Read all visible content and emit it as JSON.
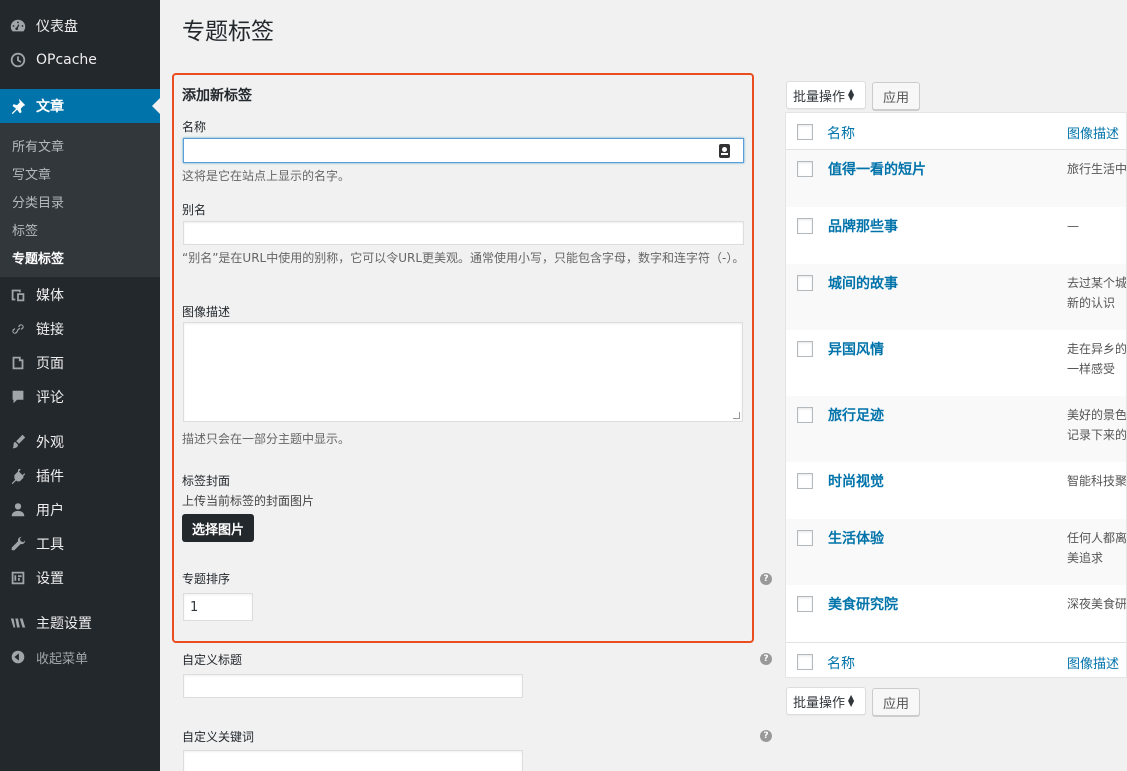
{
  "sidebar": {
    "items": [
      {
        "label": "仪表盘",
        "icon": "dashboard-icon"
      },
      {
        "label": "OPcache",
        "icon": "clock-icon"
      },
      {
        "label": "文章",
        "icon": "pin-icon"
      },
      {
        "label": "媒体",
        "icon": "media-icon"
      },
      {
        "label": "链接",
        "icon": "link-icon"
      },
      {
        "label": "页面",
        "icon": "page-icon"
      },
      {
        "label": "评论",
        "icon": "comment-icon"
      },
      {
        "label": "外观",
        "icon": "brush-icon"
      },
      {
        "label": "插件",
        "icon": "plugin-icon"
      },
      {
        "label": "用户",
        "icon": "user-icon"
      },
      {
        "label": "工具",
        "icon": "wrench-icon"
      },
      {
        "label": "设置",
        "icon": "settings-icon"
      },
      {
        "label": "主题设置",
        "icon": "theme-icon"
      }
    ],
    "submenu": [
      "所有文章",
      "写文章",
      "分类目录",
      "标签",
      "专题标签"
    ],
    "collapse_label": "收起菜单"
  },
  "page_title": "专题标签",
  "form": {
    "heading": "添加新标签",
    "name_label": "名称",
    "name_value": "",
    "name_hint": "这将是它在站点上显示的名字。",
    "slug_label": "别名",
    "slug_value": "",
    "slug_hint": "“别名”是在URL中使用的别称，它可以令URL更美观。通常使用小写，只能包含字母，数字和连字符（-）。",
    "desc_label": "图像描述",
    "desc_value": "",
    "desc_hint": "描述只会在一部分主题中显示。",
    "cover_label": "标签封面",
    "cover_hint": "上传当前标签的封面图片",
    "cover_button": "选择图片",
    "order_label": "专题排序",
    "order_value": "1",
    "custom_title_label": "自定义标题",
    "custom_title_value": "",
    "custom_keywords_label": "自定义关键词",
    "custom_keywords_value": "",
    "help_glyph": "?"
  },
  "bulk": {
    "select_label": "批量操作",
    "apply_label": "应用"
  },
  "table": {
    "col_name": "名称",
    "col_desc": "图像描述",
    "rows": [
      {
        "name": "值得一看的短片",
        "desc": "旅行生活中"
      },
      {
        "name": "品牌那些事",
        "desc": "—"
      },
      {
        "name": "城间的故事",
        "desc": "去过某个城新的认识"
      },
      {
        "name": "异国风情",
        "desc": "走在异乡的一样感受"
      },
      {
        "name": "旅行足迹",
        "desc": "美好的景色记录下来的"
      },
      {
        "name": "时尚视觉",
        "desc": "智能科技聚"
      },
      {
        "name": "生活体验",
        "desc": "任何人都离美追求"
      },
      {
        "name": "美食研究院",
        "desc": "深夜美食研"
      }
    ]
  }
}
